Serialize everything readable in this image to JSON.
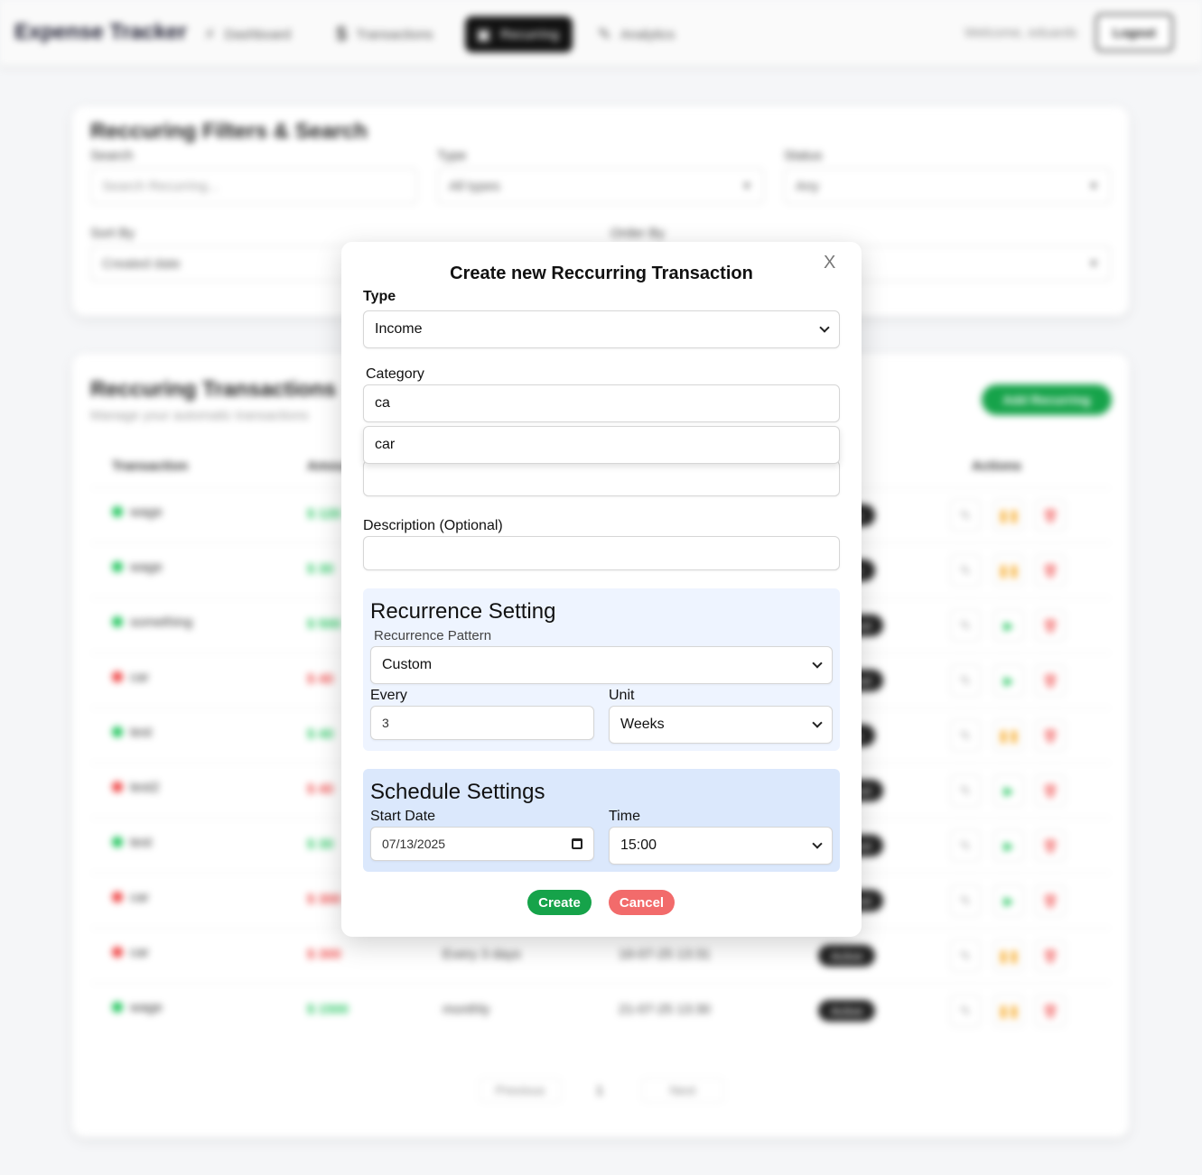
{
  "app": {
    "brand": "Expense Tracker",
    "nav": [
      {
        "icon": "⚡",
        "label": "Dashboard"
      },
      {
        "icon": "$",
        "label": "Transactions"
      },
      {
        "icon": "▣",
        "label": "Recurring"
      },
      {
        "icon": "✎",
        "label": "Analytics"
      }
    ],
    "welcome": "Welcome, eduards",
    "logout": "Logout"
  },
  "filters": {
    "title": "Reccuring Filters & Search",
    "search_label": "Search",
    "search_placeholder": "Search Recurring...",
    "type_label": "Type",
    "type_value": "All types",
    "status_label": "Status",
    "status_value": "Any",
    "sort_label": "Sort By",
    "sort_value": "Created date",
    "order_label": "Order By"
  },
  "list": {
    "title": "Reccuring Transactions",
    "subtitle": "Manage your automatic transactions",
    "add_button": "Add Recurring",
    "columns": {
      "transaction": "Transaction",
      "amount": "Amount",
      "actions": "Actions"
    },
    "rows": [
      {
        "name": "wage",
        "amount": "$ 120",
        "kind": "income",
        "frequency": "",
        "next": "",
        "status": "Active"
      },
      {
        "name": "wage",
        "amount": "$ 30",
        "kind": "income",
        "frequency": "",
        "next": "",
        "status": "Active"
      },
      {
        "name": "something",
        "amount": "$ 500",
        "kind": "income",
        "frequency": "",
        "next": "",
        "status": "Paused"
      },
      {
        "name": "car",
        "amount": "$ 40",
        "kind": "expense",
        "frequency": "",
        "next": "",
        "status": "Paused"
      },
      {
        "name": "test",
        "amount": "$ 40",
        "kind": "income",
        "frequency": "",
        "next": "",
        "status": "Active"
      },
      {
        "name": "test2",
        "amount": "$ 40",
        "kind": "expense",
        "frequency": "",
        "next": "",
        "status": "Paused"
      },
      {
        "name": "test",
        "amount": "$ 30",
        "kind": "income",
        "frequency": "",
        "next": "",
        "status": "Paused"
      },
      {
        "name": "car",
        "amount": "$ 300",
        "kind": "expense",
        "frequency": "",
        "next": "",
        "status": "Paused"
      },
      {
        "name": "car",
        "amount": "$ 300",
        "kind": "expense",
        "frequency": "Every 3 days",
        "next": "16-07-25 13:31",
        "status": "Active"
      },
      {
        "name": "wage",
        "amount": "$ 1500",
        "kind": "income",
        "frequency": "monthly",
        "next": "21-07-25 13:30",
        "status": "Active"
      }
    ],
    "pagination": {
      "previous": "Previous",
      "page": "1",
      "next": "Next"
    }
  },
  "modal": {
    "title": "Create new Reccurring Transaction",
    "close": "X",
    "type_label": "Type",
    "type_value": "Income",
    "category_label": "Category",
    "category_value": "ca",
    "category_suggestion": "car",
    "amount_value": "",
    "description_label": "Description (Optional)",
    "description_value": "",
    "recurrence": {
      "title": "Recurrence Setting",
      "pattern_label": "Recurrence Pattern",
      "pattern_value": "Custom",
      "every_label": "Every",
      "every_value": "3",
      "unit_label": "Unit",
      "unit_value": "Weeks"
    },
    "schedule": {
      "title": "Schedule Settings",
      "start_label": "Start Date",
      "start_value": "07/13/2025",
      "time_label": "Time",
      "time_value": "15:00"
    },
    "create": "Create",
    "cancel": "Cancel"
  },
  "colors": {
    "income": "#22c55e",
    "expense": "#ef4444",
    "create_button": "#16a34a",
    "cancel_button": "#f26b6b",
    "recurrence_panel": "#eef4ff",
    "schedule_panel": "#dbe8fc"
  }
}
